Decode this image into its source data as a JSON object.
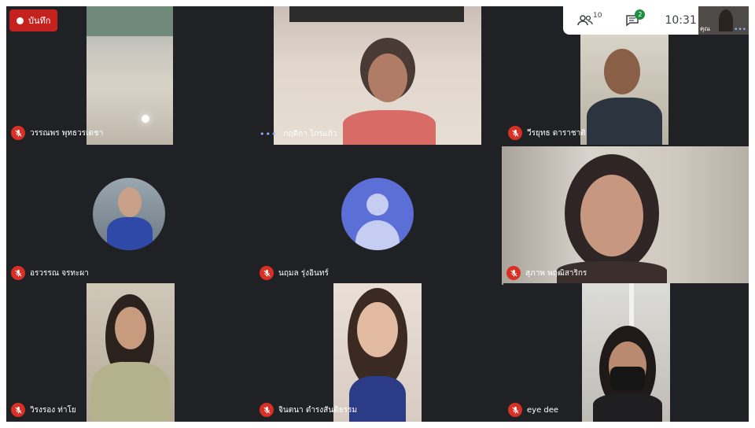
{
  "recording": {
    "label": "บันทึก"
  },
  "topbar": {
    "participants_count": "10",
    "chat_badge": "2",
    "time": "10:31",
    "self_label": "คุณ"
  },
  "participants": [
    {
      "name": "วรรณพร พุทธวรเดชา",
      "muted": true
    },
    {
      "name": "กฤติกา ไกรแก้ว",
      "muted": false
    },
    {
      "name": "วีรยุทธ ดาราชาติ",
      "muted": true
    },
    {
      "name": "อรวรรณ จรทะผา",
      "muted": true
    },
    {
      "name": "นฤมล รุ่งอินทร์",
      "muted": true
    },
    {
      "name": "สุภาพ พฤฒิสาริกร",
      "muted": true
    },
    {
      "name": "วิรงรอง ท่าโย",
      "muted": true
    },
    {
      "name": "จินตนา ดำรงสันติธรรม",
      "muted": true
    },
    {
      "name": "eye dee",
      "muted": true
    }
  ],
  "colors": {
    "tile_bg": "#202124",
    "mic_off": "#d93025",
    "record": "#c5221f",
    "avatar": "#5b6fd6"
  }
}
